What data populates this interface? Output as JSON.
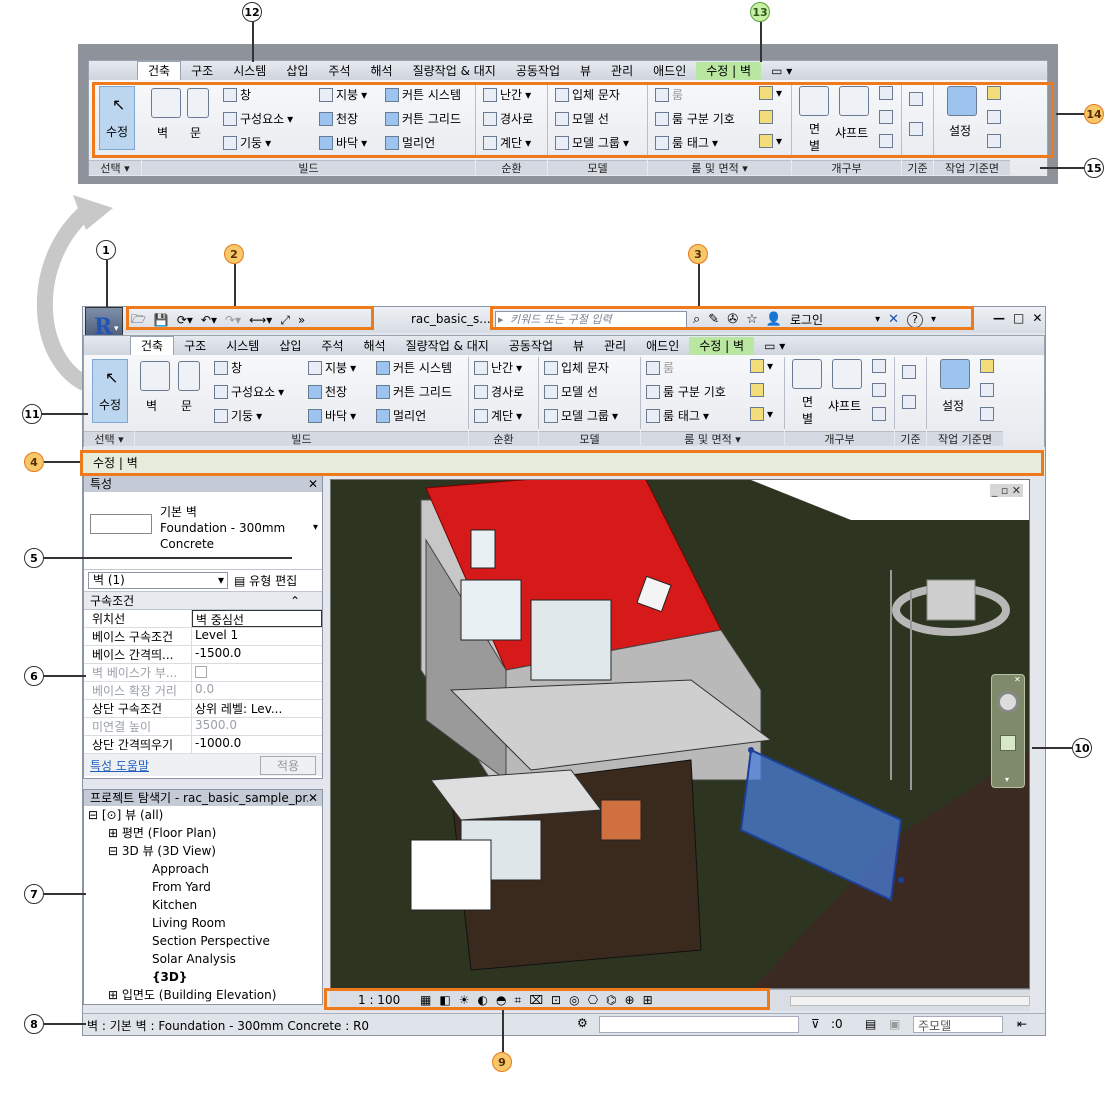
{
  "callouts": {
    "n1": "1",
    "n2": "2",
    "n3": "3",
    "n4": "4",
    "n5": "5",
    "n6": "6",
    "n7": "7",
    "n8": "8",
    "n9": "9",
    "n10": "10",
    "n11": "11",
    "n12": "12",
    "n13": "13",
    "n14": "14",
    "n15": "15"
  },
  "ribbon": {
    "tabs": [
      "건축",
      "구조",
      "시스템",
      "삽입",
      "주석",
      "해석",
      "질량작업 & 대지",
      "공동작업",
      "뷰",
      "관리",
      "애드인",
      "수정 | 벽"
    ],
    "panels": [
      "선택 ▾",
      "빌드",
      "순환",
      "모델",
      "룸 및 면적 ▾",
      "개구부",
      "기준",
      "작업 기준면"
    ],
    "modify": "수정",
    "wall": "벽",
    "door": "문",
    "window": "창",
    "component": "구성요소",
    "column": "기둥",
    "roof": "지붕",
    "ceiling": "천장",
    "floor": "바닥",
    "curtain_system": "커튼 시스템",
    "curtain_grid": "커튼 그리드",
    "mullion": "멀리언",
    "railing": "난간",
    "ramp": "경사로",
    "stair": "계단",
    "model_text": "입체 문자",
    "model_line": "모델 선",
    "model_group": "모델 그룹",
    "room": "룸",
    "room_separator": "룸 구분 기호",
    "room_tag": "룸 태그",
    "by_face": "면",
    "by_face2": "별",
    "shaft": "샤프트",
    "set": "설정"
  },
  "titlebar": {
    "filename": "rac_basic_s...",
    "search_placeholder": "키워드 또는 구절 입력",
    "login": "로그인",
    "help": "?"
  },
  "options_bar": "수정 | 벽",
  "properties": {
    "title": "특성",
    "type_name": "기본 벽",
    "type_sub": "Foundation - 300mm",
    "type_sub2": "Concrete",
    "selector": "벽 (1)",
    "edit_type": "유형 편집",
    "group": "구속조건",
    "rows": [
      {
        "k": "위치선",
        "v": "벽 중심선"
      },
      {
        "k": "베이스 구속조건",
        "v": "Level 1"
      },
      {
        "k": "베이스 간격띄...",
        "v": "-1500.0"
      },
      {
        "k": "벽 베이스가 부...",
        "v": ""
      },
      {
        "k": "베이스 확장 거리",
        "v": "0.0"
      },
      {
        "k": "상단 구속조건",
        "v": "상위 레벨: Lev..."
      },
      {
        "k": "미연결 높이",
        "v": "3500.0"
      },
      {
        "k": "상단 간격띄우기",
        "v": "-1000.0"
      }
    ],
    "help_link": "특성 도움말",
    "apply": "적용"
  },
  "browser": {
    "title": "프로젝트 탐색기 - rac_basic_sample_pr...",
    "items": [
      "뷰 (all)",
      "평면 (Floor Plan)",
      "3D 뷰 (3D View)",
      "Approach",
      "From Yard",
      "Kitchen",
      "Living Room",
      "Section Perspective",
      "Solar Analysis",
      "{3D}",
      "입면도 (Building Elevation)"
    ]
  },
  "viewbar": {
    "scale": "1 : 100"
  },
  "statusbar": {
    "text": "벽 : 기본 벽 : Foundation - 300mm Concrete : R0",
    "count": ":0",
    "model": "주모델"
  }
}
